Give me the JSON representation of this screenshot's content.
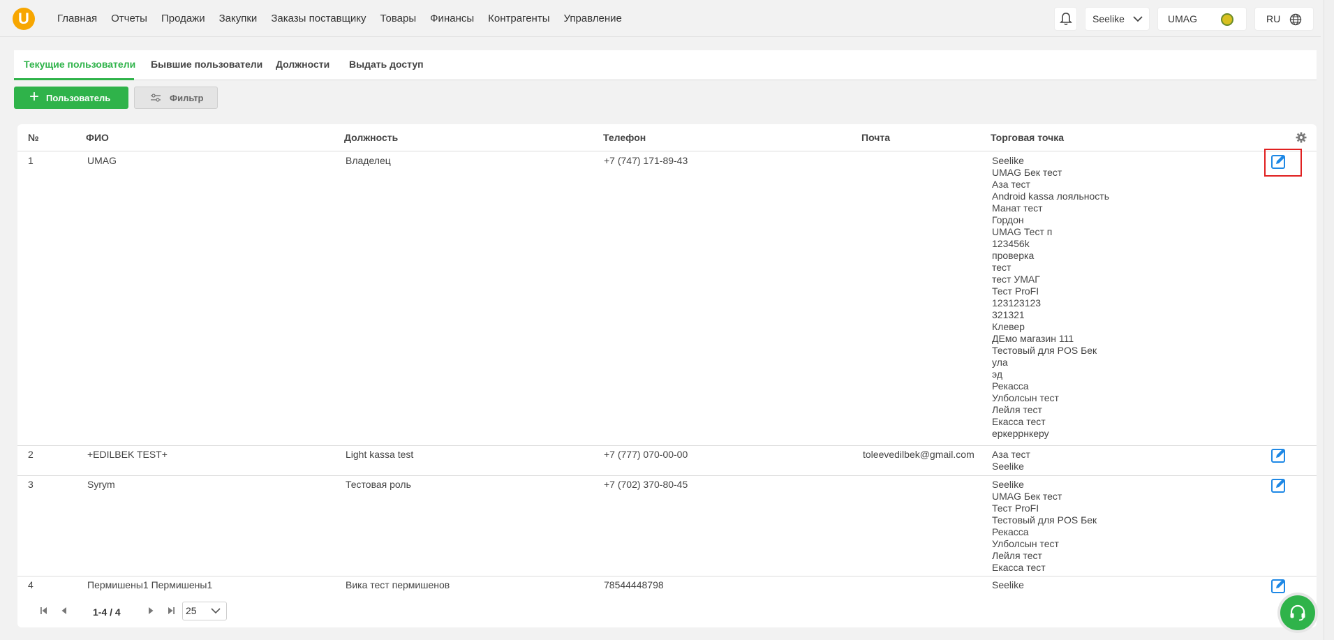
{
  "nav": {
    "logo_letter": "U",
    "menu": [
      "Главная",
      "Отчеты",
      "Продажи",
      "Закупки",
      "Заказы поставщику",
      "Товары",
      "Финансы",
      "Контрагенты",
      "Управление"
    ],
    "company": "Seelike",
    "user": "UMAG",
    "lang": "RU",
    "icons": [
      "bell-icon",
      "chevron-down-icon",
      "avatar",
      "globe-icon"
    ]
  },
  "tabs": [
    "Текущие пользователи",
    "Бывшие пользователи",
    "Должности",
    "Выдать доступ"
  ],
  "active_tab": 0,
  "toolbar": {
    "add_label": "Пользователь",
    "filter_label": "Фильтр"
  },
  "table": {
    "columns": [
      "№",
      "ФИО",
      "Должность",
      "Телефон",
      "Почта",
      "Торговая точка"
    ],
    "rows": [
      {
        "num": "1",
        "name": "UMAG",
        "role": "Владелец",
        "phone": "+7 (747) 171-89-43",
        "email": "",
        "stores": [
          "Seelike",
          "UMAG Бек тест",
          "Аза тест",
          "Android kassa лояльность",
          "Манат тест",
          "Гордон",
          "UMAG Тест п",
          "123456k",
          "проверка",
          "тест",
          "тест УМАГ",
          "Тест ProFI",
          "123123123",
          "321321",
          "Клевер",
          "ДЕмо магазин 111",
          "Тестовый для POS Бек",
          "ула",
          "эд",
          "Рекасса",
          "Улболсын тест",
          "Лейля тест",
          "Екасса тест",
          "еркеррнкеру"
        ]
      },
      {
        "num": "2",
        "name": "+EDILBEK TEST+",
        "role": "Light kassa test",
        "phone": "+7 (777) 070-00-00",
        "email": "toleevedilbek@gmail.com",
        "stores": [
          "Аза тест",
          "Seelike"
        ]
      },
      {
        "num": "3",
        "name": "Syrym",
        "role": "Тестовая роль",
        "phone": "+7 (702) 370-80-45",
        "email": "",
        "stores": [
          "Seelike",
          "UMAG Бек тест",
          "Тест ProFI",
          "Тестовый для POS Бек",
          "Рекасса",
          "Улболсын тест",
          "Лейля тест",
          "Екасса тест"
        ]
      },
      {
        "num": "4",
        "name": "Пермишены1 Пермишены1",
        "role": "Вика тест пермишенов",
        "phone": "78544448798",
        "email": "",
        "stores": [
          "Seelike"
        ]
      }
    ]
  },
  "pagination": {
    "range": "1-4 / 4",
    "page_size": "25"
  },
  "colors": {
    "accent": "#2fb34a",
    "logo": "#f7a600",
    "edit_icon": "#1e88e5",
    "highlight": "#e02020"
  }
}
